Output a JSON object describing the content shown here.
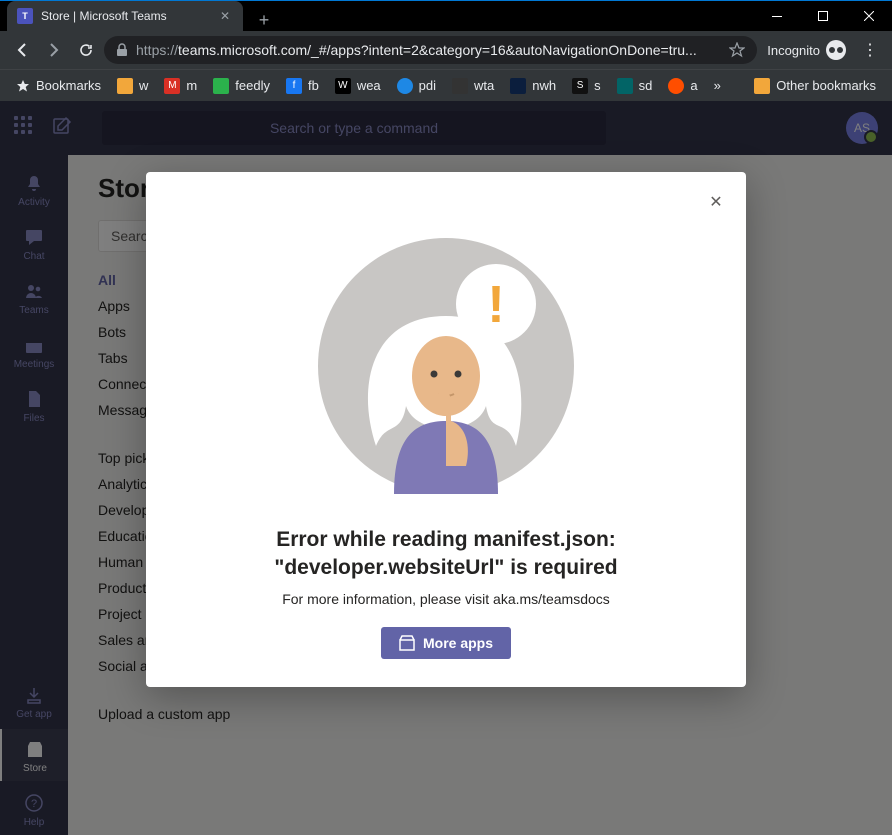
{
  "window": {
    "tab_title": "Store | Microsoft Teams",
    "url_scheme": "https://",
    "url_rest": "teams.microsoft.com/_#/apps?intent=2&category=16&autoNavigationOnDone=tru...",
    "incognito_label": "Incognito"
  },
  "bookmarks": {
    "main": "Bookmarks",
    "items": [
      {
        "label": "w",
        "color": "#f2a73b"
      },
      {
        "label": "m",
        "color": "#d93025"
      },
      {
        "label": "feedly",
        "color": "#2bb24c"
      },
      {
        "label": "fb",
        "color": "#1877f2"
      },
      {
        "label": "wea",
        "color": "#000"
      },
      {
        "label": "pdi",
        "color": "#1e88e5"
      },
      {
        "label": "wta",
        "color": "#333"
      },
      {
        "label": "nwh",
        "color": "#0b1e3d"
      },
      {
        "label": "s",
        "color": "#111"
      },
      {
        "label": "sd",
        "color": "#026466"
      },
      {
        "label": "a",
        "color": "#ff4e00"
      }
    ],
    "other": "Other bookmarks"
  },
  "teams": {
    "search_placeholder": "Search or type a command",
    "avatar_initials": "AS",
    "rail": [
      {
        "label": "Activity"
      },
      {
        "label": "Chat"
      },
      {
        "label": "Teams"
      },
      {
        "label": "Meetings"
      },
      {
        "label": "Files"
      }
    ],
    "rail_bottom": [
      {
        "label": "Get app"
      },
      {
        "label": "Store"
      },
      {
        "label": "Help"
      }
    ]
  },
  "store": {
    "title": "Store",
    "search_placeholder": "Search",
    "categories_top": [
      "All",
      "Apps",
      "Bots",
      "Tabs",
      "Connectors",
      "Messaging"
    ],
    "categories_mid": [
      "Top picks",
      "Analytics",
      "Developer",
      "Education",
      "Human resources",
      "Productivity",
      "Project management",
      "Sales and support",
      "Social and fun"
    ],
    "upload_label": "Upload a custom app"
  },
  "modal": {
    "title": "Error while reading manifest.json: \"developer.websiteUrl\" is required",
    "subtitle": "For more information, please visit aka.ms/teamsdocs",
    "button_label": "More apps"
  }
}
